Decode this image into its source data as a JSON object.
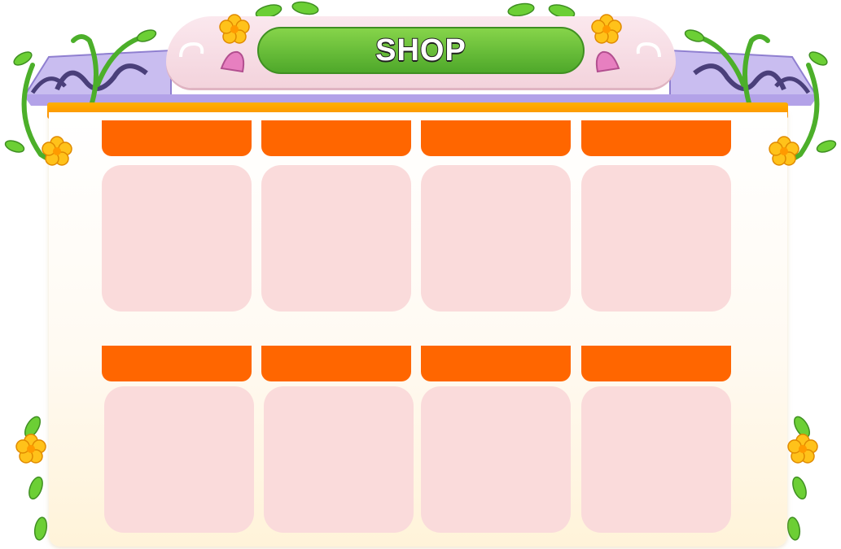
{
  "title": "SHOP",
  "colors": {
    "slot_header": "#ff6600",
    "slot_body": "#fadbdb",
    "title_pill": "#5cb833",
    "top_bar": "#ff9800",
    "arch": "#f6dde4",
    "lattice": "#b9a8e6",
    "vine": "#4caf2a",
    "flower": "#ffc21a"
  },
  "icons": [
    "flower-icon",
    "leaf-icon",
    "vine-decoration",
    "lattice-ornament",
    "pink-gem-icon"
  ],
  "shop_slots": [
    {
      "label": "",
      "item": ""
    },
    {
      "label": "",
      "item": ""
    },
    {
      "label": "",
      "item": ""
    },
    {
      "label": "",
      "item": ""
    },
    {
      "label": "",
      "item": ""
    },
    {
      "label": "",
      "item": ""
    },
    {
      "label": "",
      "item": ""
    },
    {
      "label": "",
      "item": ""
    }
  ]
}
